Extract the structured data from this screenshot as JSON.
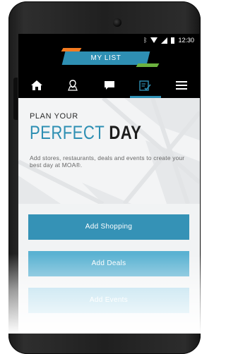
{
  "status_bar": {
    "time": "12:30",
    "icons": [
      "bluetooth-icon",
      "wifi-icon",
      "signal-icon",
      "battery-icon"
    ]
  },
  "header": {
    "title": "MY LIST"
  },
  "nav": {
    "items": [
      {
        "name": "home-icon"
      },
      {
        "name": "map-icon"
      },
      {
        "name": "chat-icon"
      },
      {
        "name": "my-list-icon",
        "active": true
      },
      {
        "name": "menu-icon"
      }
    ]
  },
  "hero": {
    "kicker": "PLAN YOUR",
    "headline_word1": "PERFECT",
    "headline_word2": "DAY",
    "description": "Add stores, restaurants, deals and events to create your best day at MOA®."
  },
  "buttons": {
    "shopping": "Add Shopping",
    "deals": "Add Deals",
    "events": "Add Events"
  },
  "colors": {
    "accent_blue": "#2e8fb3",
    "accent_orange": "#f47b20",
    "accent_green": "#6cb33f"
  }
}
